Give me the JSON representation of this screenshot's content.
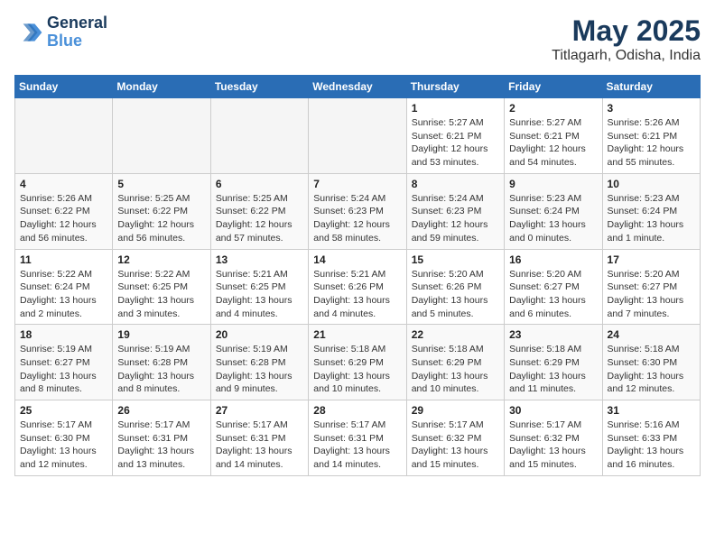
{
  "header": {
    "logo_line1": "General",
    "logo_line2": "Blue",
    "month": "May 2025",
    "location": "Titlagarh, Odisha, India"
  },
  "weekdays": [
    "Sunday",
    "Monday",
    "Tuesday",
    "Wednesday",
    "Thursday",
    "Friday",
    "Saturday"
  ],
  "weeks": [
    [
      {
        "day": "",
        "info": ""
      },
      {
        "day": "",
        "info": ""
      },
      {
        "day": "",
        "info": ""
      },
      {
        "day": "",
        "info": ""
      },
      {
        "day": "1",
        "info": "Sunrise: 5:27 AM\nSunset: 6:21 PM\nDaylight: 12 hours\nand 53 minutes."
      },
      {
        "day": "2",
        "info": "Sunrise: 5:27 AM\nSunset: 6:21 PM\nDaylight: 12 hours\nand 54 minutes."
      },
      {
        "day": "3",
        "info": "Sunrise: 5:26 AM\nSunset: 6:21 PM\nDaylight: 12 hours\nand 55 minutes."
      }
    ],
    [
      {
        "day": "4",
        "info": "Sunrise: 5:26 AM\nSunset: 6:22 PM\nDaylight: 12 hours\nand 56 minutes."
      },
      {
        "day": "5",
        "info": "Sunrise: 5:25 AM\nSunset: 6:22 PM\nDaylight: 12 hours\nand 56 minutes."
      },
      {
        "day": "6",
        "info": "Sunrise: 5:25 AM\nSunset: 6:22 PM\nDaylight: 12 hours\nand 57 minutes."
      },
      {
        "day": "7",
        "info": "Sunrise: 5:24 AM\nSunset: 6:23 PM\nDaylight: 12 hours\nand 58 minutes."
      },
      {
        "day": "8",
        "info": "Sunrise: 5:24 AM\nSunset: 6:23 PM\nDaylight: 12 hours\nand 59 minutes."
      },
      {
        "day": "9",
        "info": "Sunrise: 5:23 AM\nSunset: 6:24 PM\nDaylight: 13 hours\nand 0 minutes."
      },
      {
        "day": "10",
        "info": "Sunrise: 5:23 AM\nSunset: 6:24 PM\nDaylight: 13 hours\nand 1 minute."
      }
    ],
    [
      {
        "day": "11",
        "info": "Sunrise: 5:22 AM\nSunset: 6:24 PM\nDaylight: 13 hours\nand 2 minutes."
      },
      {
        "day": "12",
        "info": "Sunrise: 5:22 AM\nSunset: 6:25 PM\nDaylight: 13 hours\nand 3 minutes."
      },
      {
        "day": "13",
        "info": "Sunrise: 5:21 AM\nSunset: 6:25 PM\nDaylight: 13 hours\nand 4 minutes."
      },
      {
        "day": "14",
        "info": "Sunrise: 5:21 AM\nSunset: 6:26 PM\nDaylight: 13 hours\nand 4 minutes."
      },
      {
        "day": "15",
        "info": "Sunrise: 5:20 AM\nSunset: 6:26 PM\nDaylight: 13 hours\nand 5 minutes."
      },
      {
        "day": "16",
        "info": "Sunrise: 5:20 AM\nSunset: 6:27 PM\nDaylight: 13 hours\nand 6 minutes."
      },
      {
        "day": "17",
        "info": "Sunrise: 5:20 AM\nSunset: 6:27 PM\nDaylight: 13 hours\nand 7 minutes."
      }
    ],
    [
      {
        "day": "18",
        "info": "Sunrise: 5:19 AM\nSunset: 6:27 PM\nDaylight: 13 hours\nand 8 minutes."
      },
      {
        "day": "19",
        "info": "Sunrise: 5:19 AM\nSunset: 6:28 PM\nDaylight: 13 hours\nand 8 minutes."
      },
      {
        "day": "20",
        "info": "Sunrise: 5:19 AM\nSunset: 6:28 PM\nDaylight: 13 hours\nand 9 minutes."
      },
      {
        "day": "21",
        "info": "Sunrise: 5:18 AM\nSunset: 6:29 PM\nDaylight: 13 hours\nand 10 minutes."
      },
      {
        "day": "22",
        "info": "Sunrise: 5:18 AM\nSunset: 6:29 PM\nDaylight: 13 hours\nand 10 minutes."
      },
      {
        "day": "23",
        "info": "Sunrise: 5:18 AM\nSunset: 6:29 PM\nDaylight: 13 hours\nand 11 minutes."
      },
      {
        "day": "24",
        "info": "Sunrise: 5:18 AM\nSunset: 6:30 PM\nDaylight: 13 hours\nand 12 minutes."
      }
    ],
    [
      {
        "day": "25",
        "info": "Sunrise: 5:17 AM\nSunset: 6:30 PM\nDaylight: 13 hours\nand 12 minutes."
      },
      {
        "day": "26",
        "info": "Sunrise: 5:17 AM\nSunset: 6:31 PM\nDaylight: 13 hours\nand 13 minutes."
      },
      {
        "day": "27",
        "info": "Sunrise: 5:17 AM\nSunset: 6:31 PM\nDaylight: 13 hours\nand 14 minutes."
      },
      {
        "day": "28",
        "info": "Sunrise: 5:17 AM\nSunset: 6:31 PM\nDaylight: 13 hours\nand 14 minutes."
      },
      {
        "day": "29",
        "info": "Sunrise: 5:17 AM\nSunset: 6:32 PM\nDaylight: 13 hours\nand 15 minutes."
      },
      {
        "day": "30",
        "info": "Sunrise: 5:17 AM\nSunset: 6:32 PM\nDaylight: 13 hours\nand 15 minutes."
      },
      {
        "day": "31",
        "info": "Sunrise: 5:16 AM\nSunset: 6:33 PM\nDaylight: 13 hours\nand 16 minutes."
      }
    ]
  ]
}
